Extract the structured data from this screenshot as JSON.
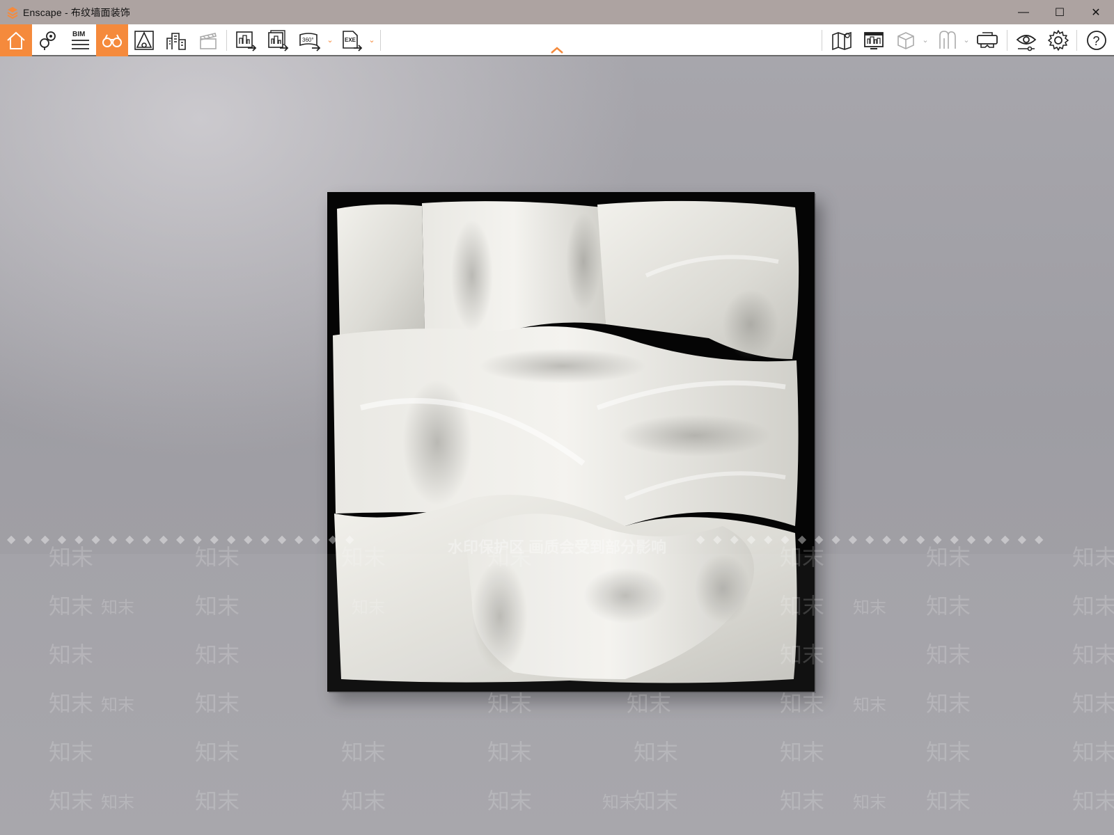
{
  "window": {
    "app_name": "Enscape",
    "title": "Enscape - 布纹墙面装饰",
    "controls": {
      "minimize": "—",
      "maximize": "☐",
      "close": "✕"
    }
  },
  "toolbar": {
    "left_buttons": [
      {
        "name": "home-icon",
        "active": true
      },
      {
        "name": "map-pin-icon",
        "active": false
      },
      {
        "name": "bim-icon",
        "label": "BIM",
        "active": false
      },
      {
        "name": "binoculars-icon",
        "active": true
      },
      {
        "name": "perspective-icon",
        "active": false
      },
      {
        "name": "buildings-icon",
        "active": false
      },
      {
        "name": "clapper-icon",
        "active": false
      },
      {
        "name": "render-image-icon",
        "active": false
      },
      {
        "name": "batch-render-icon",
        "active": false
      },
      {
        "name": "panorama-360-icon",
        "label": "360°",
        "active": false
      },
      {
        "name": "export-exe-icon",
        "label": "EXE",
        "active": false
      }
    ],
    "right_buttons": [
      {
        "name": "map-icon"
      },
      {
        "name": "monitor-icon"
      },
      {
        "name": "cube-icon"
      },
      {
        "name": "mannequin-icon"
      },
      {
        "name": "vr-headset-icon"
      },
      {
        "name": "eye-settings-icon"
      },
      {
        "name": "gear-icon"
      },
      {
        "name": "help-icon",
        "label": "?"
      }
    ],
    "accent_color": "#f58a3c"
  },
  "watermark": {
    "banner_text": "水印保护区  画质会受到部分影响",
    "mark_text": "知末"
  }
}
